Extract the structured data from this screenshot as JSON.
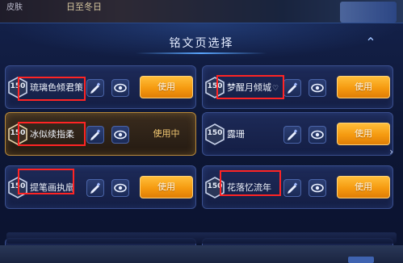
{
  "background": {
    "tab_left": "皮肤",
    "tab_mid": "日至冬日"
  },
  "dialog": {
    "title": "铭文页选择",
    "close_icon": "close-icon",
    "next_icon": "chevron-right-icon"
  },
  "pages": [
    {
      "level": "150",
      "name": "琉璃色倾君策",
      "heart": "",
      "action": "使用",
      "active": false
    },
    {
      "level": "150",
      "name": "梦醒月倾城",
      "heart": "♡",
      "action": "使用",
      "active": false
    },
    {
      "level": "150",
      "name": "冰似续指柔",
      "heart": "",
      "action": "使用中",
      "active": true
    },
    {
      "level": "150",
      "name": "露珊",
      "heart": "",
      "action": "使用",
      "active": false
    },
    {
      "level": "150",
      "name": "提笔画执扇",
      "heart": "",
      "action": "使用",
      "active": false
    },
    {
      "level": "150",
      "name": "花落忆流年",
      "heart": "",
      "action": "使用",
      "active": false
    }
  ],
  "colors": {
    "use_button": "#f59a10",
    "highlight_box": "#ff2424",
    "active_border": "#b8893a"
  }
}
